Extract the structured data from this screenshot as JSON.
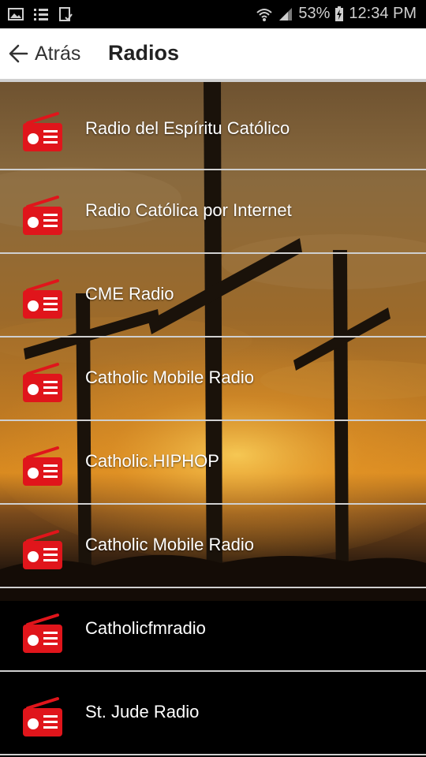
{
  "status_bar": {
    "battery": "53%",
    "time": "12:34 PM",
    "icons": [
      "image-icon",
      "list-icon",
      "clipboard-check-icon",
      "wifi-icon",
      "signal-icon",
      "battery-charging-icon"
    ]
  },
  "app_bar": {
    "back_label": "Atrás",
    "title": "Radios"
  },
  "colors": {
    "icon_red": "#e0151b",
    "divider": "#cfcfcf"
  },
  "radios": [
    {
      "label": "Radio del Espíritu Católico"
    },
    {
      "label": "Radio Católica por Internet"
    },
    {
      "label": "CME Radio"
    },
    {
      "label": "Catholic Mobile Radio"
    },
    {
      "label": "Catholic.HIPHOP"
    },
    {
      "label": "Catholic Mobile Radio"
    },
    {
      "label": "Catholicfmradio"
    },
    {
      "label": "St. Jude Radio"
    }
  ]
}
